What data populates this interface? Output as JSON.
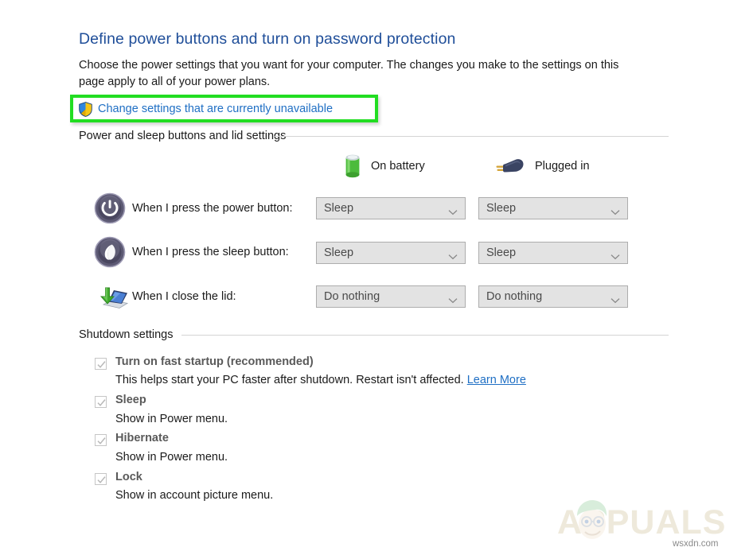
{
  "header": {
    "title": "Define power buttons and turn on password protection",
    "intro": "Choose the power settings that you want for your computer. The changes you make to the settings on this page apply to all of your power plans.",
    "uac_link": "Change settings that are currently unavailable",
    "uac_icon": "shield-icon",
    "highlight_color": "#22dd22"
  },
  "groups": {
    "power_buttons": "Power and sleep buttons and lid settings",
    "shutdown": "Shutdown settings"
  },
  "columns": [
    {
      "label": "On battery",
      "icon": "battery-icon"
    },
    {
      "label": "Plugged in",
      "icon": "power-plug-icon"
    }
  ],
  "settings_rows": [
    {
      "icon": "power-button-icon",
      "label": "When I press the power button:",
      "on_battery": "Sleep",
      "plugged_in": "Sleep"
    },
    {
      "icon": "sleep-button-icon",
      "label": "When I press the sleep button:",
      "on_battery": "Sleep",
      "plugged_in": "Sleep"
    },
    {
      "icon": "laptop-lid-icon",
      "label": "When I close the lid:",
      "on_battery": "Do nothing",
      "plugged_in": "Do nothing"
    }
  ],
  "shutdown_items": [
    {
      "label": "Turn on fast startup (recommended)",
      "checked": true,
      "description": "This helps start your PC faster after shutdown. Restart isn't affected.",
      "link": "Learn More"
    },
    {
      "label": "Sleep",
      "checked": true,
      "description": "Show in Power menu.",
      "link": ""
    },
    {
      "label": "Hibernate",
      "checked": true,
      "description": "Show in Power menu.",
      "link": ""
    },
    {
      "label": "Lock",
      "checked": true,
      "description": "Show in account picture menu.",
      "link": ""
    }
  ],
  "watermark": {
    "brand": "APPUALS",
    "site": "wsxdn.com"
  }
}
